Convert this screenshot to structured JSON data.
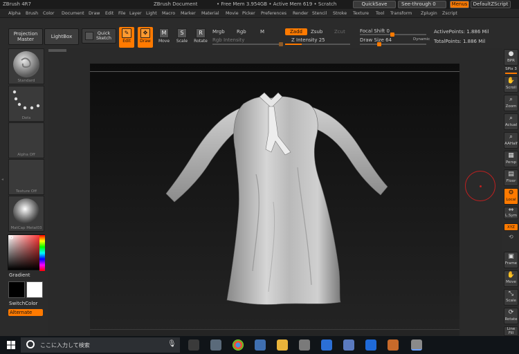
{
  "titlebar": {
    "app_title": "ZBrush 4R7",
    "doc_title": "ZBrush Document",
    "mem_info": "• Free Mem 3.954GB • Active Mem 619 • Scratch",
    "quicksave": "QuickSave",
    "see_through": "See-through   0",
    "menus": "Menus",
    "default_script": "DefaultZScript"
  },
  "menubar": [
    "Alpha",
    "Brush",
    "Color",
    "Document",
    "Draw",
    "Edit",
    "File",
    "Layer",
    "Light",
    "Macro",
    "Marker",
    "Material",
    "Movie",
    "Picker",
    "Preferences",
    "Render",
    "Stencil",
    "Stroke",
    "Texture",
    "Tool",
    "Transform",
    "Zplugin",
    "Zscript"
  ],
  "toolbar": {
    "projection_master_1": "Projection",
    "projection_master_2": "Master",
    "lightbox": "LightBox",
    "quick_sketch_1": "Quick",
    "quick_sketch_2": "Sketch",
    "edit": "Edit",
    "draw": "Draw",
    "move": "Move",
    "scale": "Scale",
    "rotate": "Rotate",
    "mrgb": "Mrgb",
    "rgb": "Rgb",
    "m": "M",
    "rgb_intensity": "Rgb Intensity",
    "zadd": "Zadd",
    "zsub": "Zsub",
    "zcut": "Zcut",
    "z_intensity": "Z Intensity 25",
    "focal_shift": "Focal Shift 0",
    "draw_size": "Draw Size 64",
    "dynamic": "Dynamic",
    "active_points": "ActivePoints: 1.886 Mil",
    "total_points": "TotalPoints: 1.886 Mil",
    "z_intensity_value": 25,
    "draw_size_value": 64
  },
  "leftpanel": {
    "brush": "Standard",
    "stroke": "Dots",
    "alpha": "Alpha Off",
    "texture": "Texture Off",
    "material": "MatCap Metal03",
    "gradient": "Gradient",
    "switch_color": "SwitchColor",
    "alternate": "Alternate"
  },
  "rightpanel": [
    "BPR",
    "SPix 3",
    "Scroll",
    "Zoom",
    "Actual",
    "AAHalf",
    "Persp",
    "Floor",
    "Local",
    "L.Sym",
    "XYZ",
    "Frame",
    "Move",
    "Scale",
    "Rotate",
    "Line Fill"
  ],
  "taskbar": {
    "search_placeholder": "ここに入力して検索"
  },
  "colors": {
    "accent": "#ff7a00",
    "panel": "#2b2b2b",
    "canvas": "#111111"
  }
}
